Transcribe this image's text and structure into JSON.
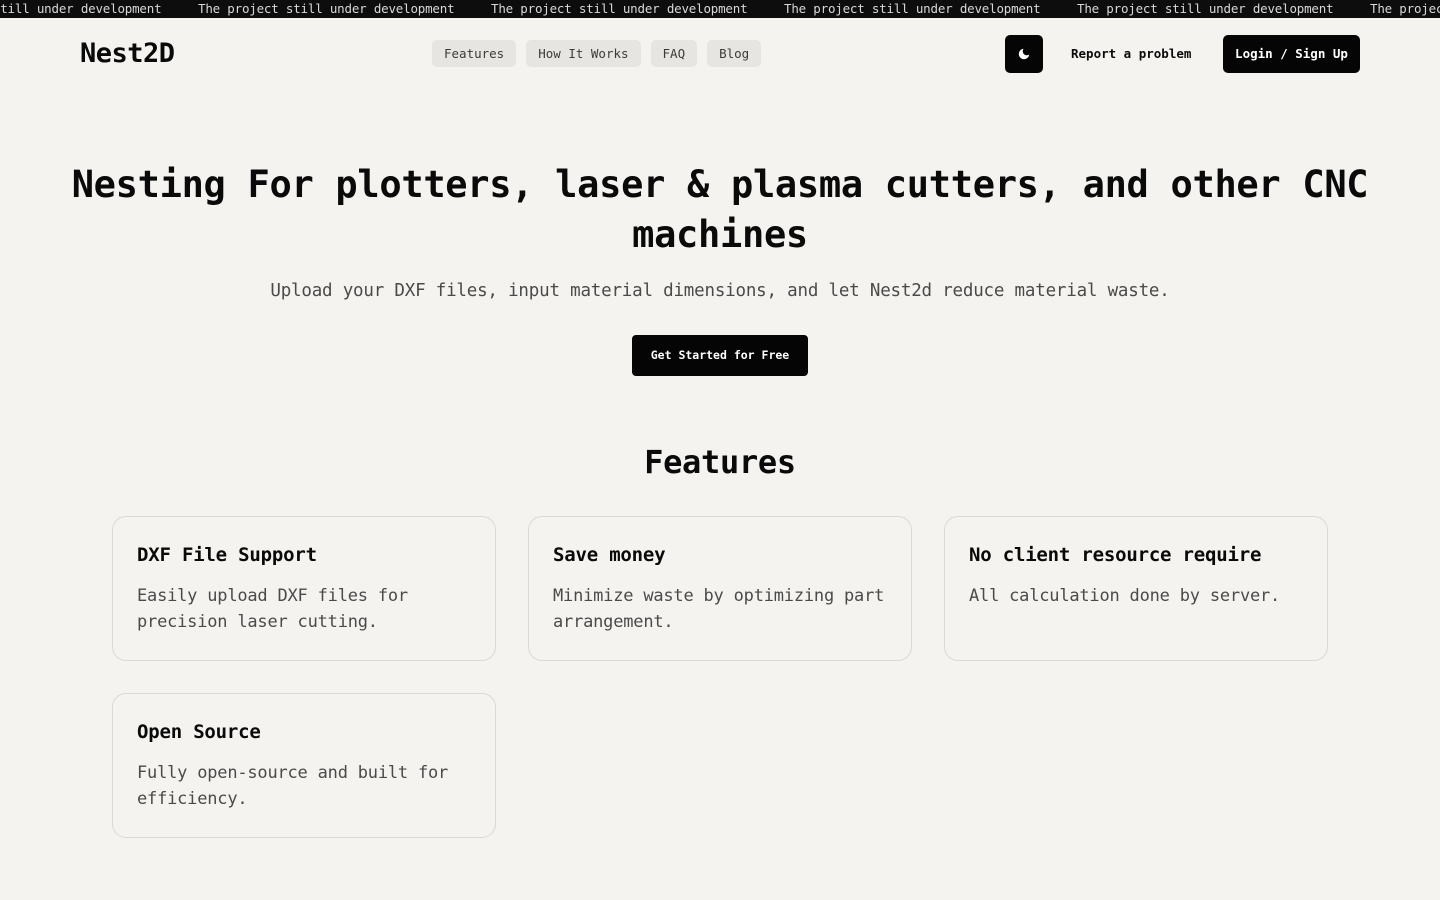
{
  "banner": {
    "items": [
      "The project still under development",
      "The project still under development",
      "The project still under development",
      "The project still under development",
      "The project still under development",
      "The project still under development"
    ]
  },
  "header": {
    "logo": "Nest2D",
    "nav": [
      "Features",
      "How It Works",
      "FAQ",
      "Blog"
    ],
    "theme_icon": "moon-icon",
    "report_label": "Report a problem",
    "login_label": "Login / Sign Up"
  },
  "hero": {
    "title": "Nesting For plotters, laser & plasma cutters, and other CNC machines",
    "subtitle": "Upload your DXF files, input material dimensions, and let Nest2d reduce material waste.",
    "cta_label": "Get Started for Free"
  },
  "features": {
    "title": "Features",
    "cards": [
      {
        "title": "DXF File Support",
        "description": "Easily upload DXF files for precision laser cutting."
      },
      {
        "title": "Save money",
        "description": "Minimize waste by optimizing part arrangement."
      },
      {
        "title": "No client resource require",
        "description": "All calculation done by server."
      },
      {
        "title": "Open Source",
        "description": "Fully open-source and built for efficiency."
      }
    ]
  },
  "colors": {
    "background": "#f4f3ef",
    "primary": "#050505",
    "banner_bg": "#0d0d0d",
    "nav_pill": "#e6e5e1",
    "card_border": "#dad9d4"
  }
}
